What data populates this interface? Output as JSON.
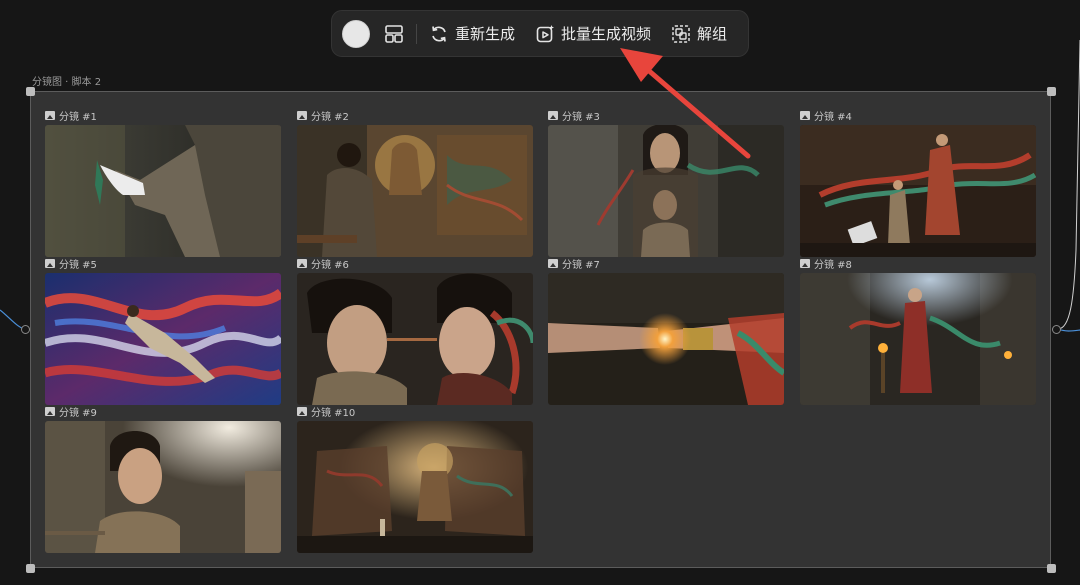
{
  "toolbar": {
    "color_swatch": "#e7e7e7",
    "layout_icon": "grid-layout-icon",
    "regenerate_label": "重新生成",
    "batch_video_label": "批量生成视频",
    "ungroup_label": "解组"
  },
  "frame": {
    "title": "分镜图 · 脚本 2"
  },
  "storyboard": {
    "shots": [
      {
        "label": "分镜 #1"
      },
      {
        "label": "分镜 #2"
      },
      {
        "label": "分镜 #3"
      },
      {
        "label": "分镜 #4"
      },
      {
        "label": "分镜 #5"
      },
      {
        "label": "分镜 #6"
      },
      {
        "label": "分镜 #7"
      },
      {
        "label": "分镜 #8"
      },
      {
        "label": "分镜 #9"
      },
      {
        "label": "分镜 #10"
      }
    ]
  },
  "colors": {
    "annotation_arrow": "#e8453c",
    "connector_line": "#4a8fd8"
  }
}
